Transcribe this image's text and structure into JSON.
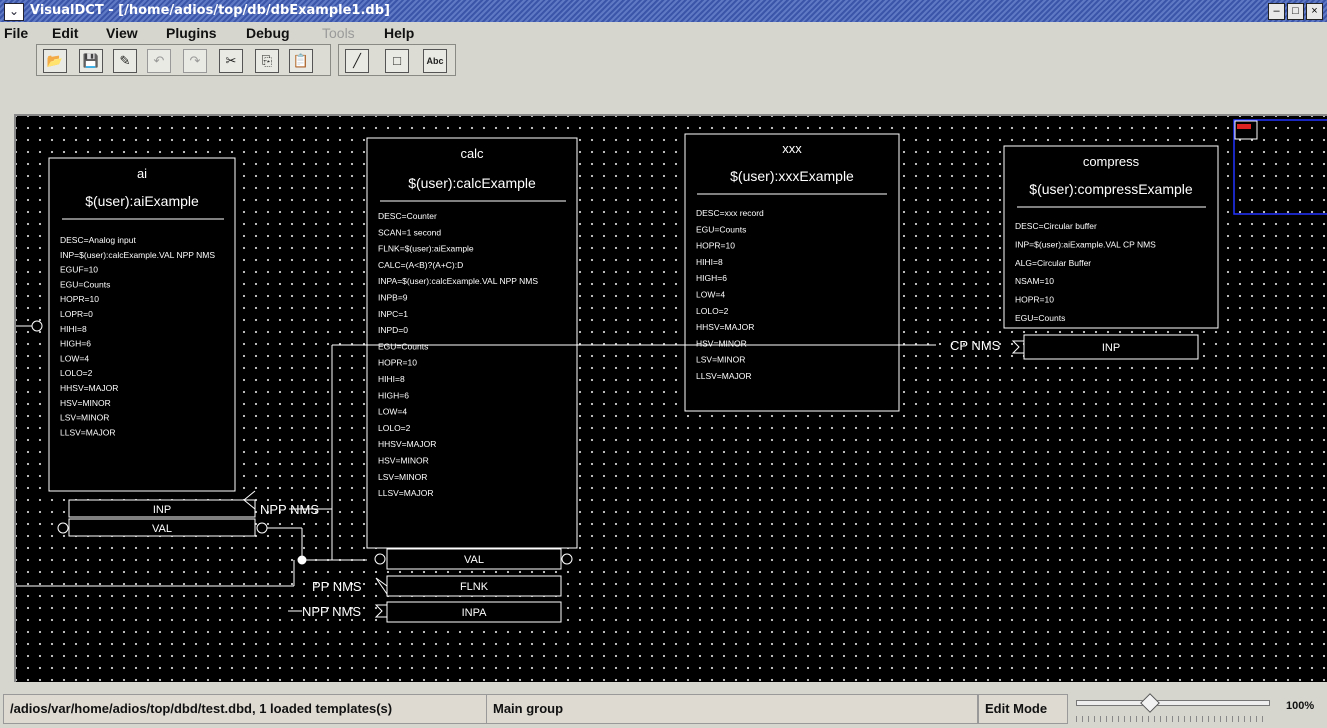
{
  "window": {
    "title": "VisualDCT - [/home/adios/top/db/dbExample1.db]",
    "menu_icon": "chevron-down-icon",
    "minimize_glyph": "–",
    "maximize_glyph": "□",
    "close_glyph": "×"
  },
  "menu": [
    {
      "label": "File",
      "enabled": true
    },
    {
      "label": "Edit",
      "enabled": true
    },
    {
      "label": "View",
      "enabled": true
    },
    {
      "label": "Plugins",
      "enabled": true
    },
    {
      "label": "Debug",
      "enabled": true
    },
    {
      "label": "Tools",
      "enabled": false
    },
    {
      "label": "Help",
      "enabled": true
    }
  ],
  "toolbar": {
    "buttons": [
      {
        "icon": "open-folder-icon",
        "glyph": "📂",
        "enabled": true
      },
      {
        "icon": "save-icon",
        "glyph": "💾",
        "enabled": true
      },
      {
        "icon": "edit-pencil-icon",
        "glyph": "✎",
        "enabled": true
      },
      {
        "icon": "undo-icon",
        "glyph": "↶",
        "enabled": false
      },
      {
        "icon": "redo-icon",
        "glyph": "↷",
        "enabled": false
      },
      {
        "icon": "cut-icon",
        "glyph": "✂",
        "enabled": true
      },
      {
        "icon": "copy-icon",
        "glyph": "⎘",
        "enabled": true
      },
      {
        "icon": "paste-icon",
        "glyph": "📋",
        "enabled": true
      }
    ],
    "draw_buttons": [
      {
        "icon": "line-tool-icon",
        "glyph": "╱"
      },
      {
        "icon": "box-tool-icon",
        "glyph": "□"
      },
      {
        "icon": "text-tool-icon",
        "glyph": "Abc"
      }
    ]
  },
  "records": [
    {
      "type": "ai",
      "name": "$(user):aiExample",
      "fields": [
        "DESC=Analog input",
        "INP=$(user):calcExample.VAL  NPP NMS",
        "EGUF=10",
        "EGU=Counts",
        "HOPR=10",
        "LOPR=0",
        "HIHI=8",
        "HIGH=6",
        "LOW=4",
        "LOLO=2",
        "HHSV=MAJOR",
        "HSV=MINOR",
        "LSV=MINOR",
        "LLSV=MAJOR"
      ],
      "ports": [
        "INP",
        "VAL"
      ]
    },
    {
      "type": "calc",
      "name": "$(user):calcExample",
      "fields": [
        "DESC=Counter",
        "SCAN=1 second",
        "FLNK=$(user):aiExample",
        "CALC=(A<B)?(A+C):D",
        "INPA=$(user):calcExample.VAL  NPP NMS",
        "INPB=9",
        "INPC=1",
        "INPD=0",
        "EGU=Counts",
        "HOPR=10",
        "HIHI=8",
        "HIGH=6",
        "LOW=4",
        "LOLO=2",
        "HHSV=MAJOR",
        "HSV=MINOR",
        "LSV=MINOR",
        "LLSV=MAJOR"
      ],
      "ports": [
        "VAL",
        "FLNK",
        "INPA"
      ]
    },
    {
      "type": "xxx",
      "name": "$(user):xxxExample",
      "fields": [
        "DESC=xxx record",
        "EGU=Counts",
        "HOPR=10",
        "HIHI=8",
        "HIGH=6",
        "LOW=4",
        "LOLO=2",
        "HHSV=MAJOR",
        "HSV=MINOR",
        "LSV=MINOR",
        "LLSV=MAJOR"
      ],
      "ports": []
    },
    {
      "type": "compress",
      "name": "$(user):compressExample",
      "fields": [
        "DESC=Circular buffer",
        "INP=$(user):aiExample.VAL CP NMS",
        "ALG=Circular Buffer",
        "NSAM=10",
        "HOPR=10",
        "EGU=Counts"
      ],
      "ports": [
        "INP"
      ]
    }
  ],
  "link_labels": {
    "ai_inp": "NPP NMS",
    "calc_flnk": "PP NMS",
    "calc_inpa": "NPP NMS",
    "compress_inp": "CP NMS"
  },
  "status": {
    "dbd_info": "/adios/var/home/adios/top/dbd/test.dbd, 1 loaded templates(s)",
    "group": "Main group",
    "mode": "Edit Mode",
    "zoom": "100%",
    "zoom_level": 1.0
  },
  "colors": {
    "canvas_bg": "#000000",
    "record_border": "#ffffff",
    "navigator_border": "#2233ff",
    "title_bar": "#4a64b4"
  }
}
